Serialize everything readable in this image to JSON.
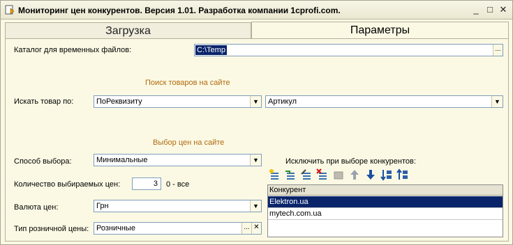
{
  "window": {
    "title": "Мониторинг цен конкурентов. Версия 1.01. Разработка компании 1cprofi.com.",
    "minimize_glyph": "_",
    "maximize_glyph": "□",
    "close_glyph": "✕"
  },
  "tabs": [
    {
      "label": "Загрузка",
      "active": false
    },
    {
      "label": "Параметры",
      "active": true
    }
  ],
  "temp_dir": {
    "label": "Каталог для временных файлов:",
    "value": "C:\\Temp",
    "button": "..."
  },
  "search_section": {
    "title": "Поиск товаров на сайте"
  },
  "search_by": {
    "label": "Искать товар по:",
    "value1": "ПоРеквизиту",
    "value2": "Артикул"
  },
  "price_section": {
    "title": "Выбор цен на сайте"
  },
  "method": {
    "label": "Способ выбора:",
    "value": "Минимальные"
  },
  "count": {
    "label": "Количество выбираемых цен:",
    "value": "3",
    "hint": "0 - все"
  },
  "currency": {
    "label": "Валюта цен:",
    "value": "Грн"
  },
  "price_type": {
    "label": "Тип розничной цены:",
    "value": "Розничные",
    "select_button": "...",
    "clear_button": "✕"
  },
  "exclude": {
    "label": "Исключить при выборе конкурентов:",
    "toolbar_icons": [
      "add-row-icon",
      "copy-row-icon",
      "edit-row-icon",
      "delete-row-icon",
      "end-edit-icon",
      "move-up-icon",
      "move-down-icon",
      "sort-asc-icon",
      "sort-desc-icon"
    ],
    "column": "Конкурент",
    "rows": [
      "Elektron.ua",
      "mytech.com.ua"
    ],
    "selected_index": 0
  },
  "colors": {
    "accent": "#0a246a",
    "section": "#b06a10",
    "background": "#fbf9e4"
  }
}
